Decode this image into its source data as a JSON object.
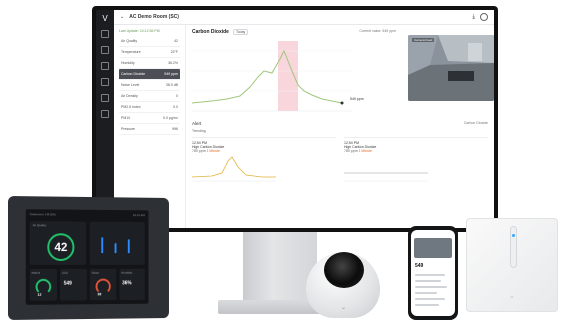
{
  "colors": {
    "accent_green": "#22c26b",
    "chart_line": "#9fc77c",
    "highlight_band": "#f9d6dc",
    "warning": "#e06c2c",
    "dark_ui": "#1b1d20"
  },
  "monitor_app": {
    "breadcrumb": "AC Demo Room (SC)",
    "readings_header": "Last Update: 10:12:36 PM",
    "readings": [
      {
        "label": "Air Quality",
        "value": "42",
        "active": false
      },
      {
        "label": "Temperature",
        "value": "23°F",
        "active": false
      },
      {
        "label": "Humidity",
        "value": "36.2%",
        "active": false
      },
      {
        "label": "Carbon Dioxide",
        "value": "549 ppm",
        "active": true
      },
      {
        "label": "Noise Level",
        "value": "38.9 dB",
        "active": false
      },
      {
        "label": "Air Density",
        "value": "0",
        "active": false
      },
      {
        "label": "PM2.5 Index",
        "value": "0.0",
        "active": false
      },
      {
        "label": "PM10",
        "value": "0.0 μg/m³",
        "active": false
      },
      {
        "label": "Pressure",
        "value": "996",
        "active": false
      }
    ],
    "chart": {
      "title": "Carbon Dioxide",
      "range_pill": "Today",
      "right_label": "Current value: 549 ppm",
      "marker_label": "549 ppm"
    },
    "camera_label": "Camera Feed",
    "alerts": {
      "title": "Alert",
      "filter": "Carbon Dioxide",
      "sub": "Trending",
      "cards": [
        {
          "time": "12:54 PM",
          "title": "High Carbon Dioxide",
          "detail": "780 ppm",
          "status": "1 Minute"
        },
        {
          "time": "12:54 PM",
          "title": "High Carbon Dioxide",
          "detail": "780 ppm",
          "status": "1 Minute"
        }
      ]
    }
  },
  "tablet": {
    "header_left": "Classroom 1-B (SA)",
    "header_right": "10:12 AM",
    "air_quality_label": "Air Quality",
    "air_quality_value": "42",
    "tiles": [
      {
        "label": "PM2.5",
        "value": "12"
      },
      {
        "label": "CO2",
        "value": "549"
      },
      {
        "label": "Noise",
        "value": "38"
      },
      {
        "label": "Humidity",
        "value": "36%"
      }
    ]
  },
  "phone": {
    "value": "549"
  }
}
